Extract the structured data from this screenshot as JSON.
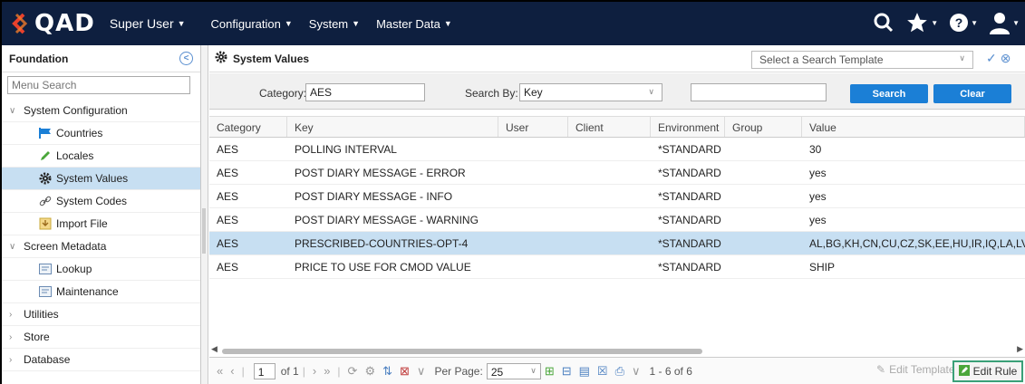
{
  "topbar": {
    "logo_text": "QAD",
    "user": "Super User",
    "nav": [
      "Configuration",
      "System",
      "Master Data"
    ]
  },
  "sidebar": {
    "title": "Foundation",
    "search_placeholder": "Menu Search",
    "items": [
      {
        "label": "System Configuration",
        "level": 0,
        "expanded": true
      },
      {
        "label": "Countries",
        "level": 1,
        "icon": "flag-icon"
      },
      {
        "label": "Locales",
        "level": 1,
        "icon": "pencil-icon"
      },
      {
        "label": "System Values",
        "level": 1,
        "icon": "gear-icon",
        "selected": true
      },
      {
        "label": "System Codes",
        "level": 1,
        "icon": "link-icon"
      },
      {
        "label": "Import File",
        "level": 1,
        "icon": "import-icon"
      },
      {
        "label": "Screen Metadata",
        "level": 0,
        "expanded": true
      },
      {
        "label": "Lookup",
        "level": 1,
        "icon": "form-icon"
      },
      {
        "label": "Maintenance",
        "level": 1,
        "icon": "form-icon"
      },
      {
        "label": "Utilities",
        "level": 0,
        "expanded": false
      },
      {
        "label": "Store",
        "level": 0,
        "expanded": false
      },
      {
        "label": "Database",
        "level": 0,
        "expanded": false
      }
    ]
  },
  "main": {
    "title": "System Values",
    "template_placeholder": "Select a Search Template",
    "filter": {
      "category_label": "Category:",
      "category_value": "AES",
      "search_by_label": "Search By:",
      "search_by_value": "Key",
      "search_value": "",
      "search_button": "Search",
      "clear_button": "Clear"
    },
    "columns": [
      "Category",
      "Key",
      "User",
      "Client",
      "Environment",
      "Group",
      "Value"
    ],
    "rows": [
      {
        "category": "AES",
        "key": "POLLING INTERVAL",
        "user": "",
        "client": "",
        "environment": "*STANDARD",
        "group": "",
        "value": "30"
      },
      {
        "category": "AES",
        "key": "POST DIARY MESSAGE - ERROR",
        "user": "",
        "client": "",
        "environment": "*STANDARD",
        "group": "",
        "value": "yes"
      },
      {
        "category": "AES",
        "key": "POST DIARY MESSAGE - INFO",
        "user": "",
        "client": "",
        "environment": "*STANDARD",
        "group": "",
        "value": "yes"
      },
      {
        "category": "AES",
        "key": "POST DIARY MESSAGE - WARNING",
        "user": "",
        "client": "",
        "environment": "*STANDARD",
        "group": "",
        "value": "yes"
      },
      {
        "category": "AES",
        "key": "PRESCRIBED-COUNTRIES-OPT-4",
        "user": "",
        "client": "",
        "environment": "*STANDARD",
        "group": "",
        "value": "AL,BG,KH,CN,CU,CZ,SK,EE,HU,IR,IQ,LA,LV,",
        "selected": true
      },
      {
        "category": "AES",
        "key": "PRICE TO USE FOR CMOD VALUE",
        "user": "",
        "client": "",
        "environment": "*STANDARD",
        "group": "",
        "value": "SHIP"
      }
    ],
    "pager": {
      "page": "1",
      "of_label": "of 1",
      "per_page_label": "Per Page:",
      "per_page": "25",
      "range": "1 - 6 of 6",
      "edit_template": "Edit Template",
      "edit_rule": "Edit Rule"
    }
  },
  "colors": {
    "topbar": "#0e1f3f",
    "accent_blue": "#1b7fd6",
    "selected_row": "#c7dff2",
    "edit_rule_border": "#3aa078"
  }
}
